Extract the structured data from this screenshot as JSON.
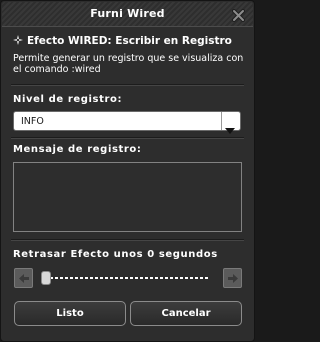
{
  "window": {
    "title": "Furni Wired"
  },
  "header": {
    "title": "Efecto WIRED: Escribir en Registro",
    "icon": "wired-star-icon"
  },
  "description": "Permite generar un registro que se visualiza con el comando :wired",
  "log_level": {
    "label": "Nivel de registro:",
    "selected": "INFO"
  },
  "message": {
    "label": "Mensaje de registro:",
    "value": ""
  },
  "delay": {
    "label": "Retrasar Efecto unos 0 segundos",
    "seconds": 0
  },
  "buttons": {
    "ok": "Listo",
    "cancel": "Cancelar"
  },
  "colors": {
    "background": "#2d2d2d",
    "text": "#ffffff",
    "border": "#8b8b8b"
  }
}
